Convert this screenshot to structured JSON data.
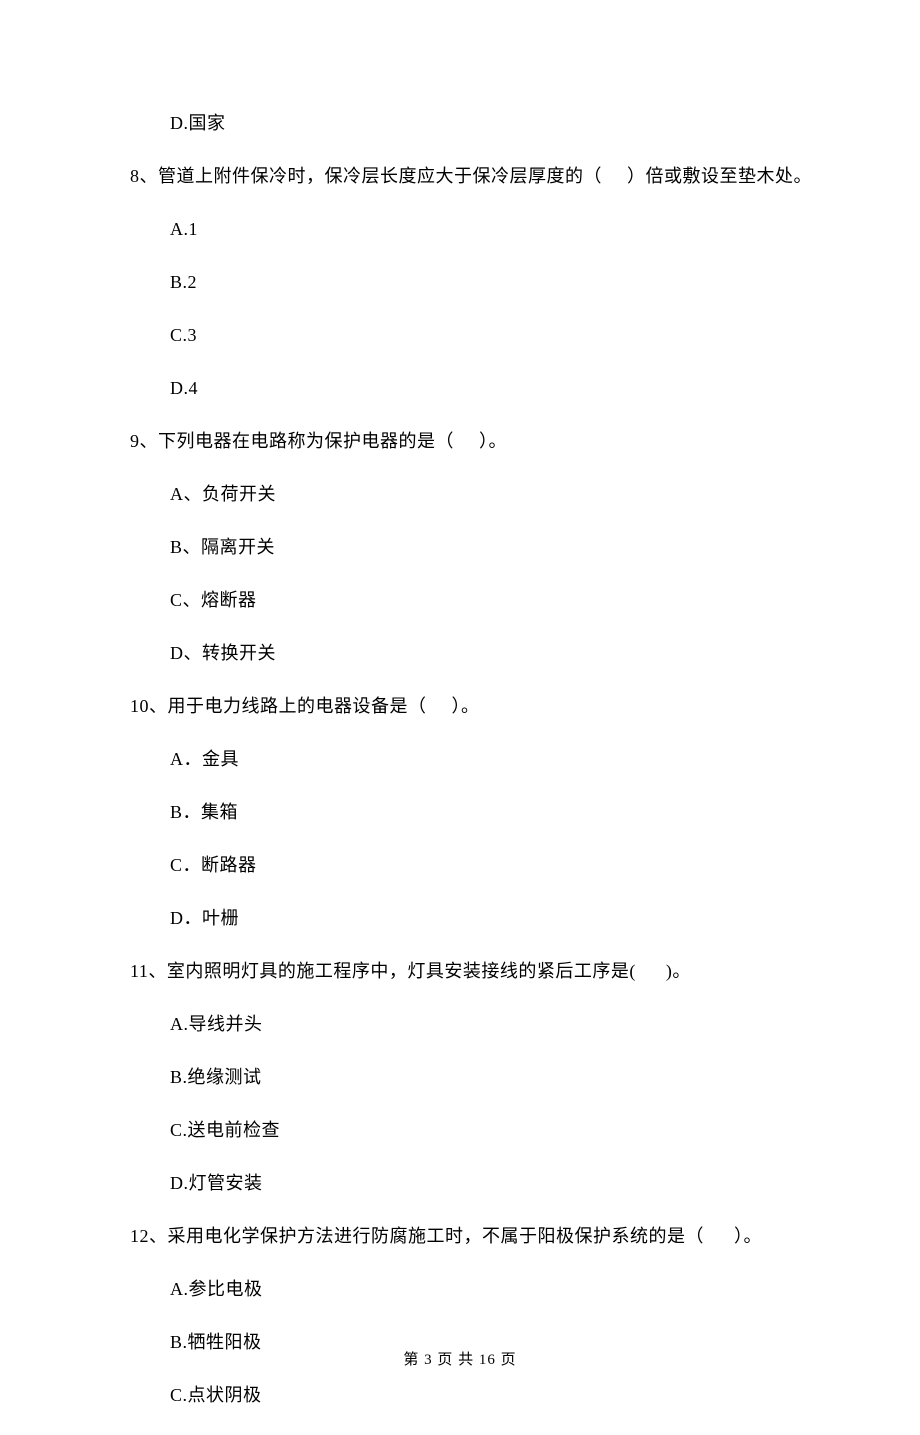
{
  "previousOptionD": "D.国家",
  "questions": [
    {
      "num": "8、",
      "stem": "管道上附件保冷时，保冷层长度应大于保冷层厚度的（     ）倍或敷设至垫木处。",
      "options": [
        "A.1",
        "B.2",
        "C.3",
        "D.4"
      ]
    },
    {
      "num": "9、",
      "stem": "下列电器在电路称为保护电器的是（     ）。",
      "options": [
        "A、负荷开关",
        "B、隔离开关",
        "C、熔断器",
        "D、转换开关"
      ]
    },
    {
      "num": "10、",
      "stem": "用于电力线路上的电器设备是（     ）。",
      "options": [
        "A．金具",
        "B．集箱",
        "C．断路器",
        "D．叶栅"
      ]
    },
    {
      "num": "11、",
      "stem": "室内照明灯具的施工程序中，灯具安装接线的紧后工序是(      )。",
      "options": [
        "A.导线并头",
        "B.绝缘测试",
        "C.送电前检查",
        "D.灯管安装"
      ]
    },
    {
      "num": "12、",
      "stem": "采用电化学保护方法进行防腐施工时，不属于阳极保护系统的是（      ）。",
      "options": [
        "A.参比电极",
        "B.牺牲阳极",
        "C.点状阴极"
      ]
    }
  ],
  "footer": "第 3 页 共 16 页"
}
